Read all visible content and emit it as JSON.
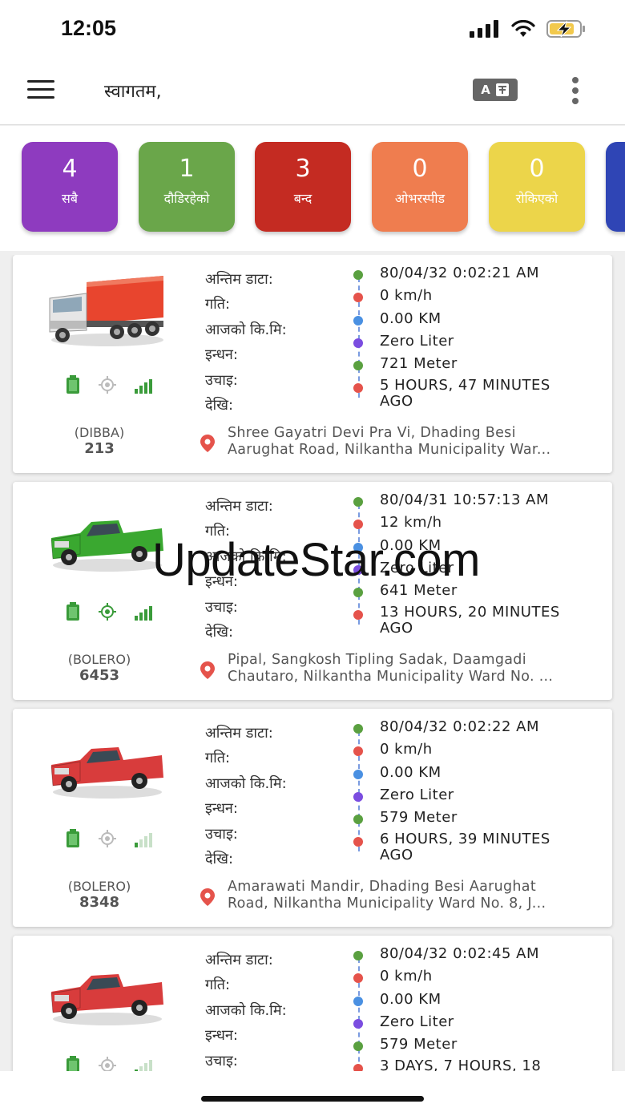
{
  "status_bar": {
    "time": "12:05"
  },
  "app_bar": {
    "title": "स्वागतम,",
    "translate_icon_text": "A"
  },
  "filters": [
    {
      "count": "4",
      "label": "सबै",
      "color": "#8e3bbf"
    },
    {
      "count": "1",
      "label": "दौडिरहेको",
      "color": "#6aa64a"
    },
    {
      "count": "3",
      "label": "बन्द",
      "color": "#c42b22"
    },
    {
      "count": "0",
      "label": "ओभरस्पीड",
      "color": "#ef7d4f"
    },
    {
      "count": "0",
      "label": "रोकिएको",
      "color": "#ecd54a"
    }
  ],
  "field_labels": [
    "अन्तिम डाटा:",
    "गति:",
    "आजको कि.मि:",
    "इन्धन:",
    "उचाइ:",
    "देखि:"
  ],
  "vehicles": [
    {
      "name": "(DIBBA)",
      "number": "213",
      "type": "truck",
      "color": "#e8452e",
      "gps_active": false,
      "signal": "strong",
      "last_data": "80/04/32 0:02:21 AM",
      "speed": "0 km/h",
      "today_km": "0.00 KM",
      "fuel": "Zero Liter",
      "altitude": "721 Meter",
      "since_line1": "5 HOURS, 47 MINUTES",
      "since_line2": "AGO",
      "address_line1": "Shree Gayatri Devi Pra Vi, Dhading Besi",
      "address_line2": "Aarughat Road, Nilkantha Municipality War..."
    },
    {
      "name": "(BOLERO)",
      "number": "6453",
      "type": "pickup",
      "color": "#3aa830",
      "gps_active": true,
      "signal": "strong",
      "last_data": "80/04/31 10:57:13 AM",
      "speed": "12 km/h",
      "today_km": "0.00 KM",
      "fuel": "Zero Liter",
      "altitude": "641 Meter",
      "since_line1": "13 HOURS, 20 MINUTES",
      "since_line2": "AGO",
      "address_line1": "Pipal, Sangkosh Tipling Sadak, Daamgadi",
      "address_line2": "Chautaro, Nilkantha Municipality Ward No. ..."
    },
    {
      "name": "(BOLERO)",
      "number": "8348",
      "type": "pickup",
      "color": "#d83c3c",
      "gps_active": false,
      "signal": "weak",
      "last_data": "80/04/32 0:02:22 AM",
      "speed": "0 km/h",
      "today_km": "0.00 KM",
      "fuel": "Zero Liter",
      "altitude": "579 Meter",
      "since_line1": "6 HOURS, 39 MINUTES",
      "since_line2": "AGO",
      "address_line1": "Amarawati Mandir, Dhading Besi Aarughat",
      "address_line2": "Road, Nilkantha Municipality Ward No. 8, J..."
    },
    {
      "name": "",
      "number": "",
      "type": "pickup",
      "color": "#d83c3c",
      "gps_active": false,
      "signal": "weak",
      "last_data": "80/04/32 0:02:45 AM",
      "speed": "0 km/h",
      "today_km": "0.00 KM",
      "fuel": "Zero Liter",
      "altitude": "579 Meter",
      "since_line1": "3 DAYS, 7 HOURS, 18",
      "since_line2": "",
      "address_line1": "",
      "address_line2": ""
    }
  ],
  "watermark": "UpdateStar.com"
}
